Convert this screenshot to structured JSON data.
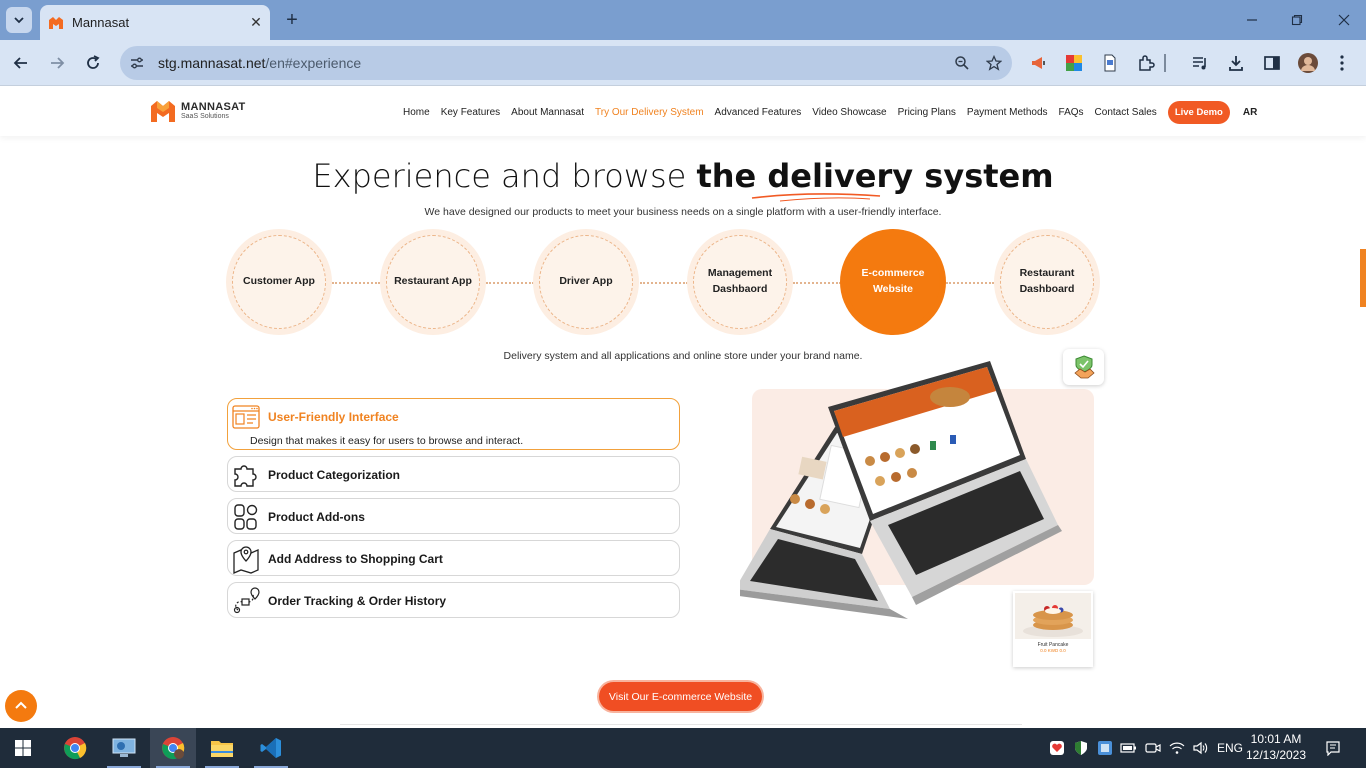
{
  "browser": {
    "tab_title": "Mannasat",
    "url_host": "stg.mannasat.net",
    "url_path": "/en#experience"
  },
  "site": {
    "logo_name": "MANNASAT",
    "logo_tagline": "SaaS Solutions",
    "nav": [
      {
        "label": "Home",
        "active": false
      },
      {
        "label": "Key Features",
        "active": false
      },
      {
        "label": "About Mannasat",
        "active": false
      },
      {
        "label": "Try Our Delivery System",
        "active": true
      },
      {
        "label": "Advanced Features",
        "active": false
      },
      {
        "label": "Video Showcase",
        "active": false
      },
      {
        "label": "Pricing Plans",
        "active": false
      },
      {
        "label": "Payment Methods",
        "active": false
      },
      {
        "label": "FAQs",
        "active": false
      },
      {
        "label": "Contact Sales",
        "active": false
      }
    ],
    "live_demo": "Live Demo",
    "lang": "AR"
  },
  "hero": {
    "title_light": "Experience and browse ",
    "title_bold": "the delivery system",
    "subtitle": "We have designed our products to meet your business needs on a single platform with a user-friendly interface."
  },
  "steps": [
    {
      "label": "Customer App",
      "active": false
    },
    {
      "label": "Restaurant App",
      "active": false
    },
    {
      "label": "Driver App",
      "active": false
    },
    {
      "label": "Management Dashbaord",
      "active": false
    },
    {
      "label": "E-commerce Website",
      "active": true
    },
    {
      "label": "Restaurant Dashboard",
      "active": false
    }
  ],
  "steps_caption": "Delivery system and all applications and online store under your brand name.",
  "features": [
    {
      "title": "User-Friendly Interface",
      "desc": "Design that makes it easy for users to browse and interact.",
      "active": true,
      "icon": "window-icon"
    },
    {
      "title": "Product Categorization",
      "active": false,
      "icon": "puzzle-icon"
    },
    {
      "title": "Product Add-ons",
      "active": false,
      "icon": "addons-icon"
    },
    {
      "title": "Add Address to Shopping Cart",
      "active": false,
      "icon": "map-pin-icon"
    },
    {
      "title": "Order Tracking & Order History",
      "active": false,
      "icon": "route-icon"
    }
  ],
  "preview_card": {
    "name": "Fruit Pancake",
    "price": "0.0 KWD 0.0"
  },
  "cta": "Visit Our E-commerce Website",
  "taskbar": {
    "lang": "ENG",
    "time": "10:01 AM",
    "date": "12/13/2023"
  },
  "colors": {
    "accent": "#f08321",
    "cta": "#f04e23",
    "step_active": "#f47a0f"
  }
}
